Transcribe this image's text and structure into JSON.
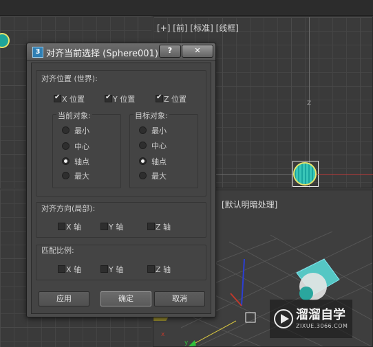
{
  "viewports": {
    "front_label": "[+] [前] [标准] [线框]",
    "perspective_label": "[默认明暗处理]"
  },
  "dialog": {
    "icon_text": "3",
    "title": "对齐当前选择 (Sphere001)",
    "help_label": "?",
    "close_label": "✕",
    "align_position": {
      "label": "对齐位置 (世界):",
      "x_label": "X 位置",
      "y_label": "Y 位置",
      "z_label": "Z 位置",
      "x_checked": true,
      "y_checked": true,
      "z_checked": true
    },
    "current_object": {
      "label": "当前对象:",
      "options": [
        "最小",
        "中心",
        "轴点",
        "最大"
      ],
      "selected": "轴点"
    },
    "target_object": {
      "label": "目标对象:",
      "options": [
        "最小",
        "中心",
        "轴点",
        "最大"
      ],
      "selected": "轴点"
    },
    "align_orientation": {
      "label": "对齐方向(局部):",
      "x_label": "X 轴",
      "y_label": "Y 轴",
      "z_label": "Z 轴"
    },
    "match_scale": {
      "label": "匹配比例:",
      "x_label": "X 轴",
      "y_label": "Y 轴",
      "z_label": "Z 轴"
    },
    "buttons": {
      "apply": "应用",
      "ok": "确定",
      "cancel": "取消"
    }
  },
  "axis_labels": {
    "z": "Z",
    "x": "x",
    "y": "y"
  },
  "watermark": {
    "title": "溜溜自学",
    "subtitle": "ZIXUE.3066.COM"
  }
}
